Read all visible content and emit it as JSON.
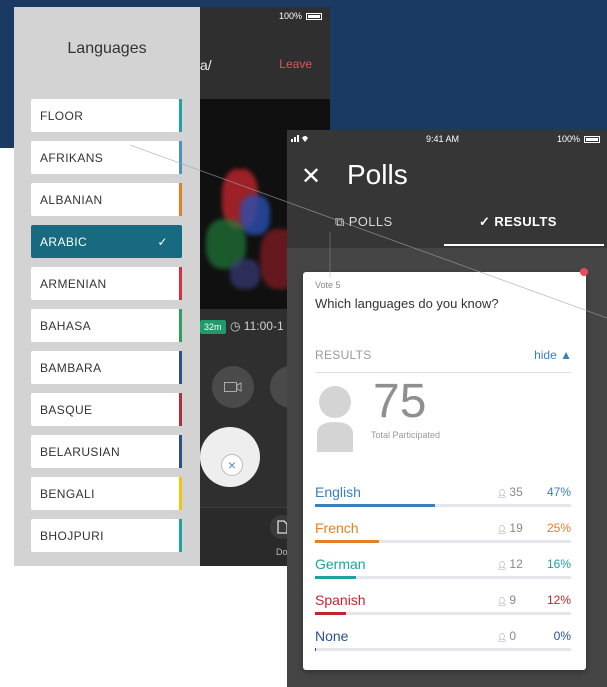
{
  "left_phone": {
    "status_battery": "100%",
    "title_fragment": "a/",
    "leave_label": "Leave",
    "duration_badge": "32m",
    "time_range": "◷ 11:00-1",
    "bottom_label": "Do"
  },
  "languages": {
    "title": "Languages",
    "items": [
      {
        "label": "FLOOR",
        "color": "#1ba39c",
        "selected": false
      },
      {
        "label": "AFRIKANS",
        "color": "#4a90c2",
        "selected": false
      },
      {
        "label": "ALBANIAN",
        "color": "#e67e22",
        "selected": false
      },
      {
        "label": "ARABIC",
        "color": "#176a80",
        "selected": true
      },
      {
        "label": "ARMENIAN",
        "color": "#d0333e",
        "selected": false
      },
      {
        "label": "BAHASA",
        "color": "#2e9e5e",
        "selected": false
      },
      {
        "label": "BAMBARA",
        "color": "#2c4f8f",
        "selected": false
      },
      {
        "label": "BASQUE",
        "color": "#b03038",
        "selected": false
      },
      {
        "label": "BELARUSIAN",
        "color": "#2c4f8f",
        "selected": false
      },
      {
        "label": "BENGALI",
        "color": "#f1c40f",
        "selected": false
      },
      {
        "label": "BHOJPURI",
        "color": "#1ba39c",
        "selected": false
      }
    ],
    "check_mark": "✓"
  },
  "right_phone": {
    "status_time": "9:41 AM",
    "status_battery": "100%",
    "close_icon": "close-icon",
    "title": "Polls",
    "tab_polls": "POLLS",
    "tab_results": "RESULTS"
  },
  "poll": {
    "vote_label": "Vote 5",
    "question": "Which languages do you know?",
    "results_header": "RESULTS",
    "hide_label": "hide ▲",
    "total": "75",
    "total_label": "Total Participated",
    "results": [
      {
        "name": "English",
        "count": "35",
        "pct": "47%",
        "fraction": 0.47,
        "color": "#3b7fbd"
      },
      {
        "name": "French",
        "count": "19",
        "pct": "25%",
        "fraction": 0.25,
        "color": "#e67e22"
      },
      {
        "name": "German",
        "count": "12",
        "pct": "16%",
        "fraction": 0.16,
        "color": "#1ba39c"
      },
      {
        "name": "Spanish",
        "count": "9",
        "pct": "12%",
        "fraction": 0.12,
        "color": "#c0262d"
      },
      {
        "name": "None",
        "count": "0",
        "pct": "0%",
        "fraction": 0.0,
        "color": "#2c4f8f"
      }
    ]
  }
}
